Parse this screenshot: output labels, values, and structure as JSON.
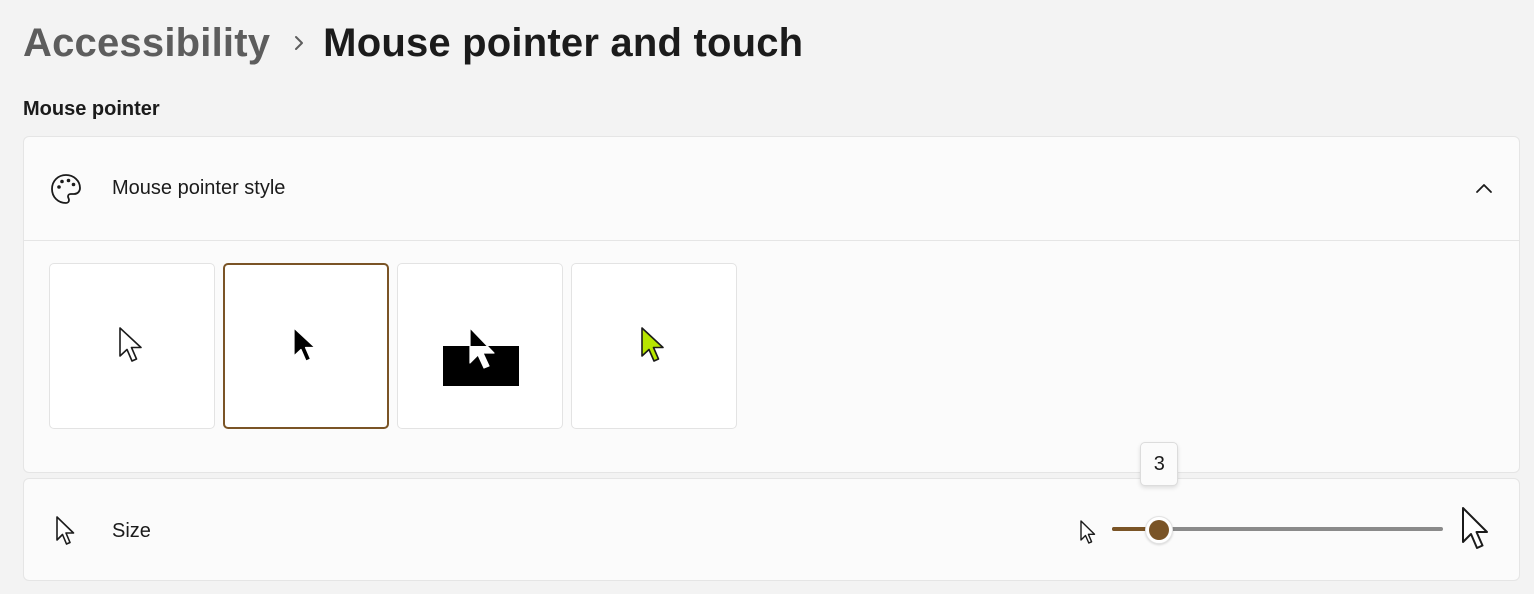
{
  "breadcrumb": {
    "parent": "Accessibility",
    "current": "Mouse pointer and touch"
  },
  "section": {
    "title": "Mouse pointer"
  },
  "pointer_style": {
    "label": "Mouse pointer style",
    "icon": "palette-icon",
    "expanded": true,
    "options": [
      {
        "name": "white",
        "icon": "cursor-white-icon",
        "selected": false
      },
      {
        "name": "black",
        "icon": "cursor-black-icon",
        "selected": true
      },
      {
        "name": "inverted",
        "icon": "cursor-inverted-icon",
        "selected": false
      },
      {
        "name": "custom",
        "icon": "cursor-custom-icon",
        "color": "#b7e600",
        "selected": false
      }
    ]
  },
  "size": {
    "label": "Size",
    "icon": "cursor-icon",
    "value": 3,
    "value_label": "3",
    "min": 1,
    "max": 15
  },
  "colors": {
    "accent": "#7a5426",
    "custom_cursor": "#b7e600"
  }
}
